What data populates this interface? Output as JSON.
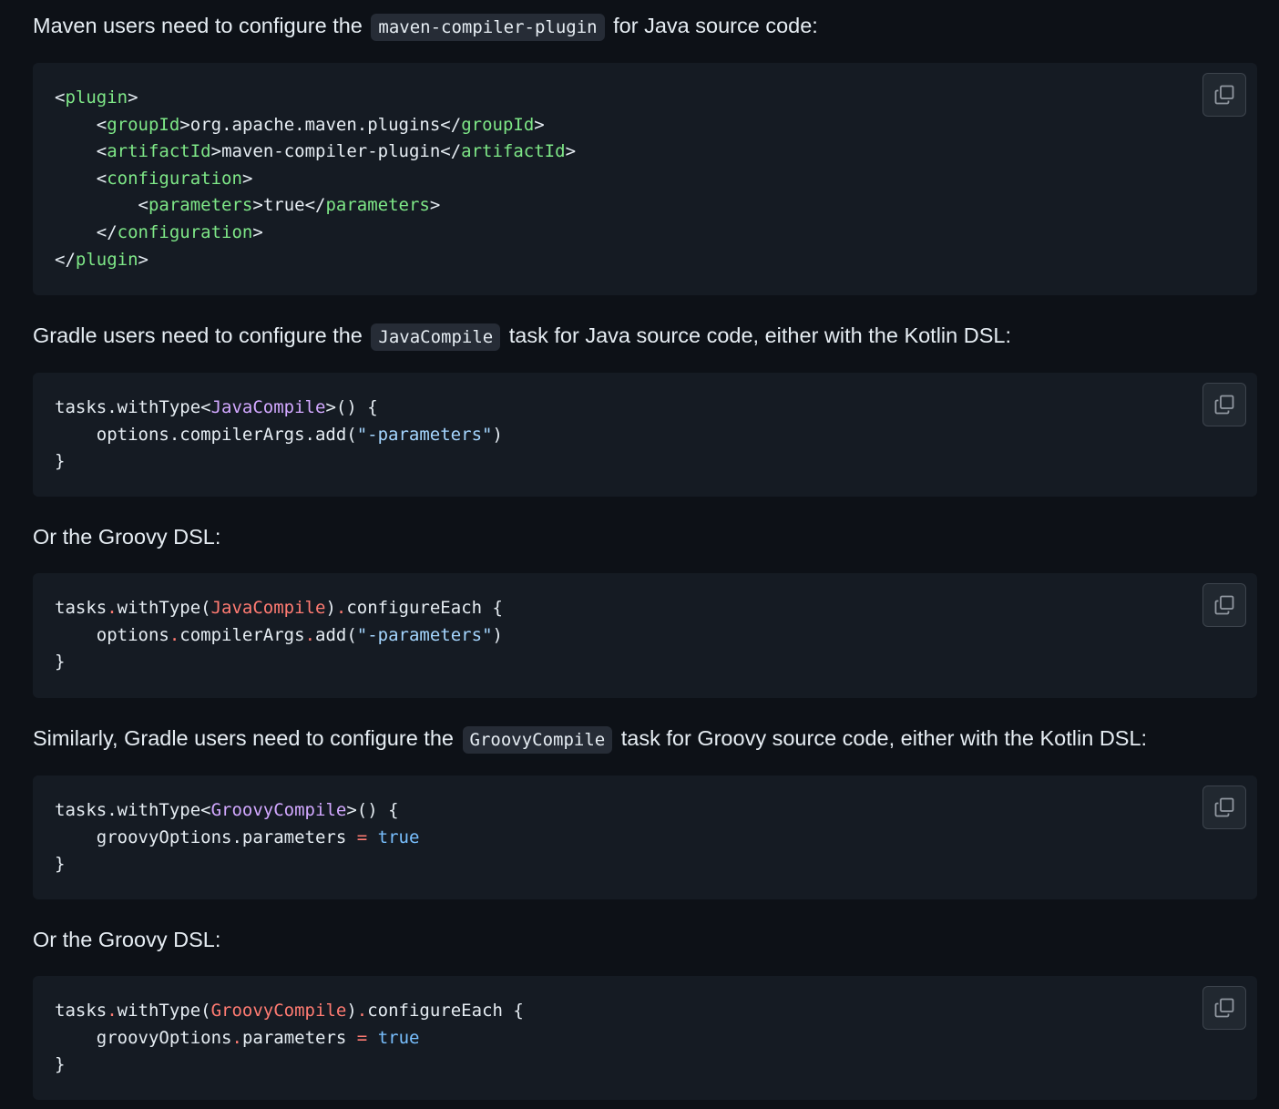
{
  "paragraphs": {
    "p1": {
      "before": "Maven users need to configure the ",
      "code": "maven-compiler-plugin",
      "after": " for Java source code:"
    },
    "p2": {
      "before": "Gradle users need to configure the ",
      "code": "JavaCompile",
      "after": " task for Java source code, either with the Kotlin DSL:"
    },
    "p3": {
      "text": "Or the Groovy DSL:"
    },
    "p4": {
      "before": "Similarly, Gradle users need to configure the ",
      "code": "GroovyCompile",
      "after": " task for Groovy source code, either with the Kotlin DSL:"
    },
    "p5": {
      "text": "Or the Groovy DSL:"
    }
  },
  "code": {
    "maven": {
      "plugin": "plugin",
      "groupId": "groupId",
      "groupId_value": "org.apache.maven.plugins",
      "artifactId": "artifactId",
      "artifactId_value": "maven-compiler-plugin",
      "configuration": "configuration",
      "parameters": "parameters",
      "parameters_value": "true"
    },
    "kotlin_java": {
      "call": "tasks.withType",
      "type": "JavaCompile",
      "suffix": ">() {",
      "line2_prefix": "    options.compilerArgs.add(",
      "arg": "\"-parameters\"",
      "line2_suffix": ")",
      "close": "}"
    },
    "groovy_java": {
      "tasks": "tasks",
      "withType": "withType(",
      "type": "JavaCompile",
      "configure": "configureEach {",
      "options": "options",
      "compilerArgs": "compilerArgs",
      "add": "add(",
      "arg": "\"-parameters\"",
      "close_paren": ")",
      "close": "}"
    },
    "kotlin_groovy": {
      "call": "tasks.withType",
      "type": "GroovyCompile",
      "suffix": ">() {",
      "line2_prefix": "    groovyOptions.parameters ",
      "eq": "=",
      "value": "true",
      "close": "}"
    },
    "groovy_groovy": {
      "tasks": "tasks",
      "withType": "withType(",
      "type": "GroovyCompile",
      "configure": "configureEach {",
      "groovyOptions": "groovyOptions",
      "parameters": "parameters ",
      "eq": "=",
      "value": "true",
      "close": "}"
    }
  },
  "icons": {
    "copy": "copy-icon"
  },
  "colors": {
    "background": "#0d1117",
    "code_background": "#151b23",
    "tag": "#7ee787",
    "type_kotlin": "#d2a8ff",
    "type_groovy": "#ff7b72",
    "string": "#a5d6ff",
    "keyword": "#79c0ff"
  }
}
